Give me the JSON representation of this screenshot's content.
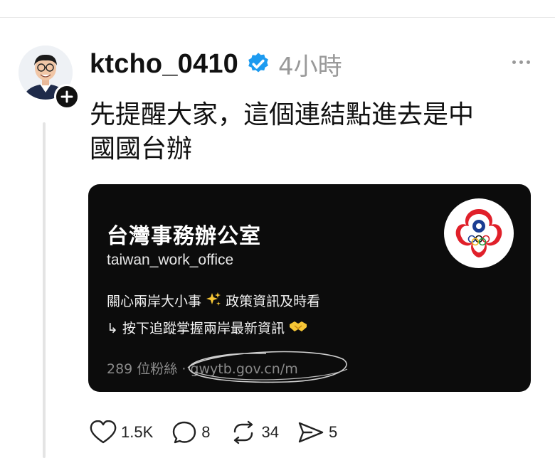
{
  "post": {
    "username": "ktcho_0410",
    "time": "4小時",
    "text_line1": "先提醒大家，這個連結點進去是中",
    "text_line2": "國國台辦"
  },
  "card": {
    "title": "台灣事務辦公室",
    "handle": "taiwan_work_office",
    "bio_line1_a": "關心兩岸大小事",
    "bio_line1_b": "政策資訊及時看",
    "bio_line2": "↳ 按下追蹤掌握兩岸最新資訊",
    "followers": "289 位粉絲 · gwytb.gov.cn/m"
  },
  "actions": {
    "likes": "1.5K",
    "comments": "8",
    "reposts": "34",
    "shares": "5"
  },
  "icons": {
    "verified": "verified-badge-icon",
    "more": "more-options-icon",
    "like": "heart-icon",
    "comment": "comment-icon",
    "repost": "repost-icon",
    "share": "share-icon"
  },
  "colors": {
    "verified_blue": "#1d9bf0",
    "card_bg": "#0c0c0c",
    "muted": "#999999"
  }
}
